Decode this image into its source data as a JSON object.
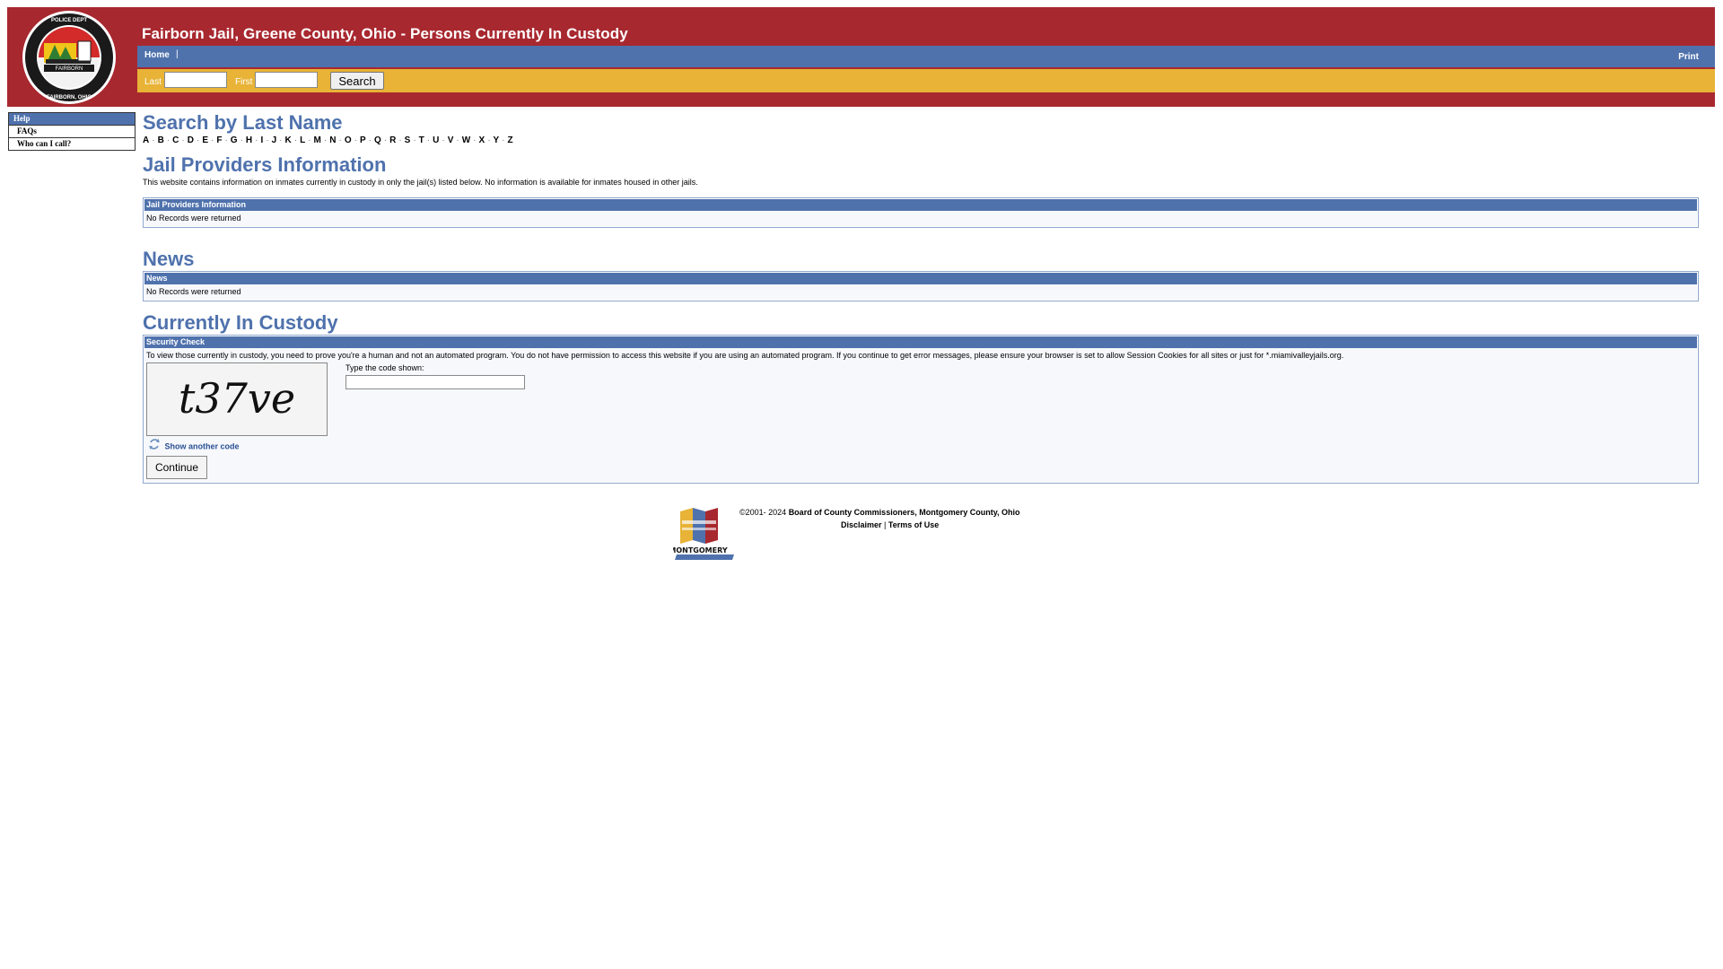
{
  "header": {
    "title": "Fairborn Jail, Greene County, Ohio - Persons Currently In Custody",
    "logo_text": "FAIRBORN POLICE DEPARTMENT · FAIRBORN, OHIO",
    "nav_home": "Home",
    "nav_separator": "|",
    "nav_print": "Print",
    "search_last_label": "Last",
    "search_last_value": "",
    "search_first_label": "First",
    "search_first_value": "",
    "search_button": "Search"
  },
  "sidebar": {
    "heading": "Help",
    "items": [
      {
        "label": "FAQs"
      },
      {
        "label": "Who can I call?"
      }
    ]
  },
  "sections": {
    "search_by_last_name": "Search by Last Name",
    "letters": [
      "A",
      "B",
      "C",
      "D",
      "E",
      "F",
      "G",
      "H",
      "I",
      "J",
      "K",
      "L",
      "M",
      "N",
      "O",
      "P",
      "Q",
      "R",
      "S",
      "T",
      "U",
      "V",
      "W",
      "X",
      "Y",
      "Z"
    ],
    "jail_providers_title": "Jail Providers Information",
    "jail_providers_desc": "This website contains information on inmates currently in custody in only the jail(s) listed below. No information is available for inmates housed in other jails.",
    "jail_providers_panel_header": "Jail Providers Information",
    "jail_providers_panel_body": "No Records were returned",
    "news_title": "News",
    "news_panel_header": "News",
    "news_panel_body": "No Records were returned",
    "custody_title": "Currently In Custody",
    "security_header": "Security Check",
    "security_text": "To view those currently in custody, you need to prove you're a human and not an automated program. You do not have permission to access this website if you are using an automated program. If you continue to get error messages, please ensure your browser is set to allow Session Cookies for all sites or just for *.miamivalleyjails.org.",
    "captcha_text": "t37ve",
    "code_label": "Type the code shown:",
    "code_value": "",
    "show_another": "Show another code",
    "continue_button": "Continue"
  },
  "footer": {
    "copyright": "©2001- 2024",
    "org": "Board of County Commissioners, Montgomery County, Ohio",
    "disclaimer": "Disclaimer",
    "separator": "|",
    "terms": "Terms of Use",
    "logo_text": "MONTGOMERY"
  },
  "colors": {
    "header_red": "#a8282f",
    "nav_blue": "#4f72ad",
    "search_gold": "#e8b336",
    "section_title": "#4f72ad"
  }
}
